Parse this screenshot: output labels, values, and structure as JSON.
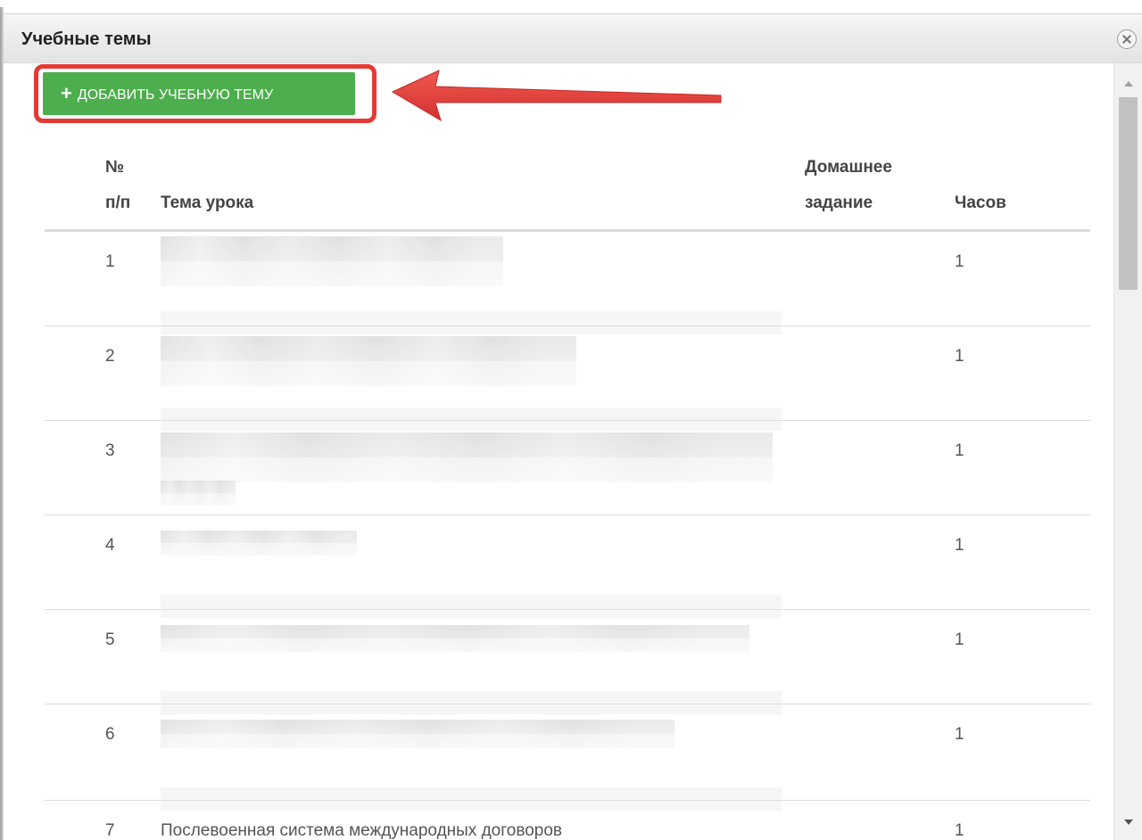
{
  "dialog": {
    "title": "Учебные темы",
    "add_button_label": "ДОБАВИТЬ УЧЕБНУЮ ТЕМУ",
    "add_button_icon": "plus-icon",
    "close_icon": "close-icon"
  },
  "colors": {
    "add_button": "#4cae4c",
    "highlight": "#e53935"
  },
  "table": {
    "headers": {
      "num_line1": "№",
      "num_line2": "п/п",
      "topic": "Тема урока",
      "homework_line1": "Домашнее",
      "homework_line2": "задание",
      "hours": "Часов"
    },
    "rows": [
      {
        "num": "1",
        "topic": "",
        "hours": "1"
      },
      {
        "num": "2",
        "topic": "",
        "hours": "1"
      },
      {
        "num": "3",
        "topic": "",
        "hours": "1"
      },
      {
        "num": "4",
        "topic": "",
        "hours": "1"
      },
      {
        "num": "5",
        "topic": "",
        "hours": "1"
      },
      {
        "num": "6",
        "topic": "",
        "hours": "1"
      },
      {
        "num": "7",
        "topic": "Послевоенная система международных договоров",
        "hours": "1"
      }
    ]
  }
}
